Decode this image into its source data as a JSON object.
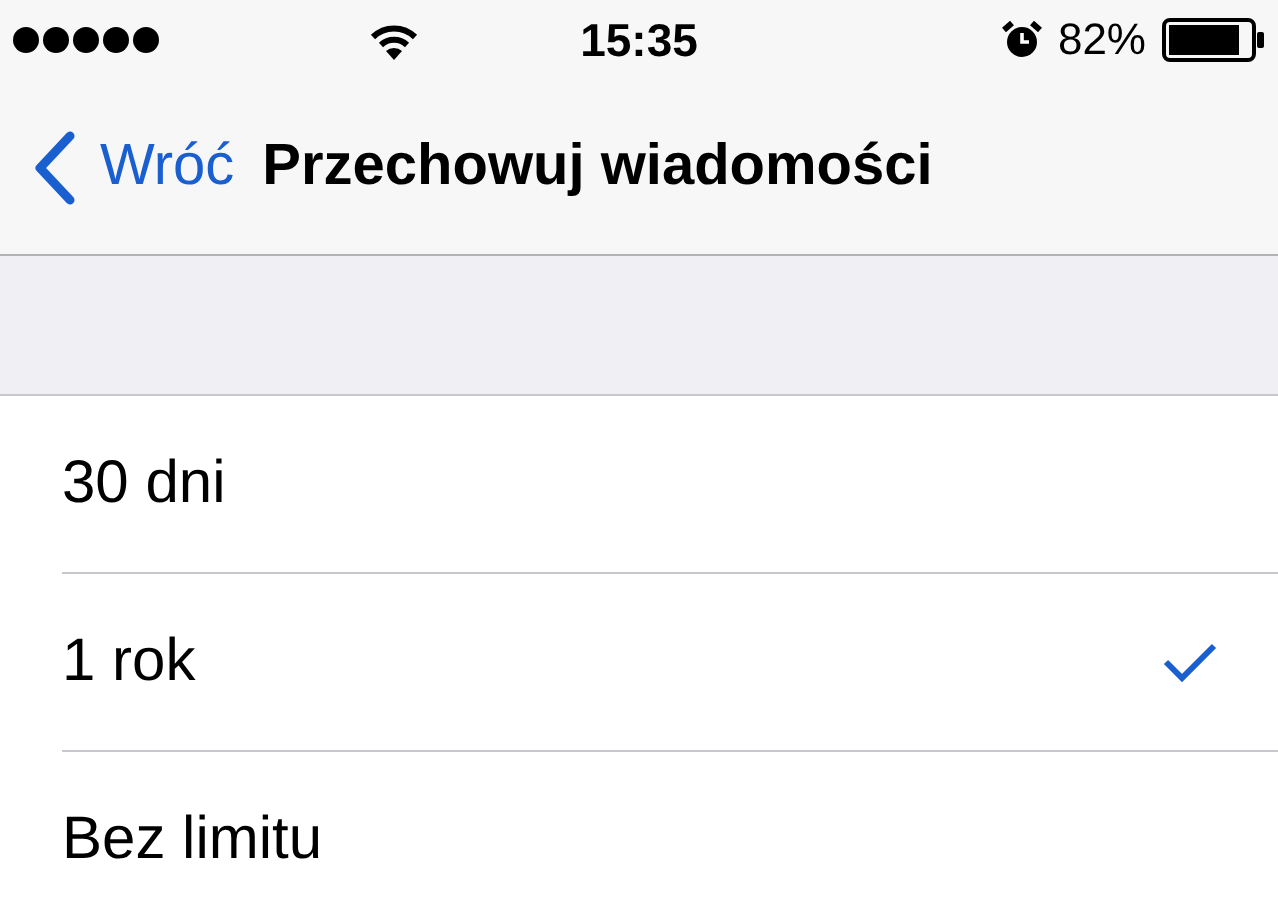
{
  "status_bar": {
    "time": "15:35",
    "battery": "82%"
  },
  "nav": {
    "back": "Wróć",
    "title": "Przechowuj wiadomości"
  },
  "options": [
    {
      "label": "30 dni",
      "selected": false
    },
    {
      "label": "1 rok",
      "selected": true
    },
    {
      "label": "Bez limitu",
      "selected": false
    }
  ]
}
